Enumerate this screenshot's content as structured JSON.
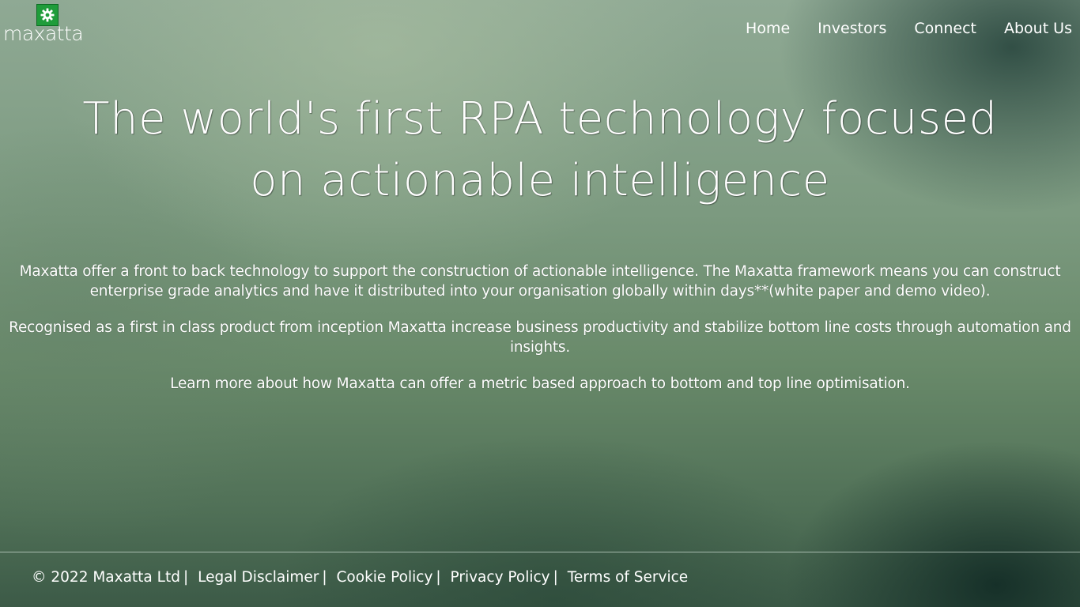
{
  "brand": {
    "name": "maxatta",
    "logo_icon": "gear-icon",
    "logo_color": "#1f9c3a"
  },
  "nav": {
    "items": [
      {
        "label": "Home"
      },
      {
        "label": "Investors"
      },
      {
        "label": "Connect"
      },
      {
        "label": "About Us"
      }
    ]
  },
  "hero": {
    "title_line1": "The world's first RPA technology focused",
    "title_line2": "on actionable intelligence"
  },
  "content": {
    "paragraphs": [
      "Maxatta offer a front to back technology to support the construction of actionable intelligence. The Maxatta framework means you can construct enterprise grade analytics and have it distributed into your organisation globally within days**(white paper and demo video).",
      "Recognised as a first in class product from inception Maxatta increase business productivity and stabilize bottom line costs through automation and insights.",
      "Learn more about how Maxatta can offer a metric based approach to bottom and top line optimisation."
    ]
  },
  "footer": {
    "copyright": "© 2022 Maxatta Ltd",
    "separator": "|",
    "links": [
      {
        "label": "Legal Disclaimer"
      },
      {
        "label": "Cookie Policy"
      },
      {
        "label": "Privacy Policy"
      },
      {
        "label": "Terms of Service"
      }
    ]
  }
}
